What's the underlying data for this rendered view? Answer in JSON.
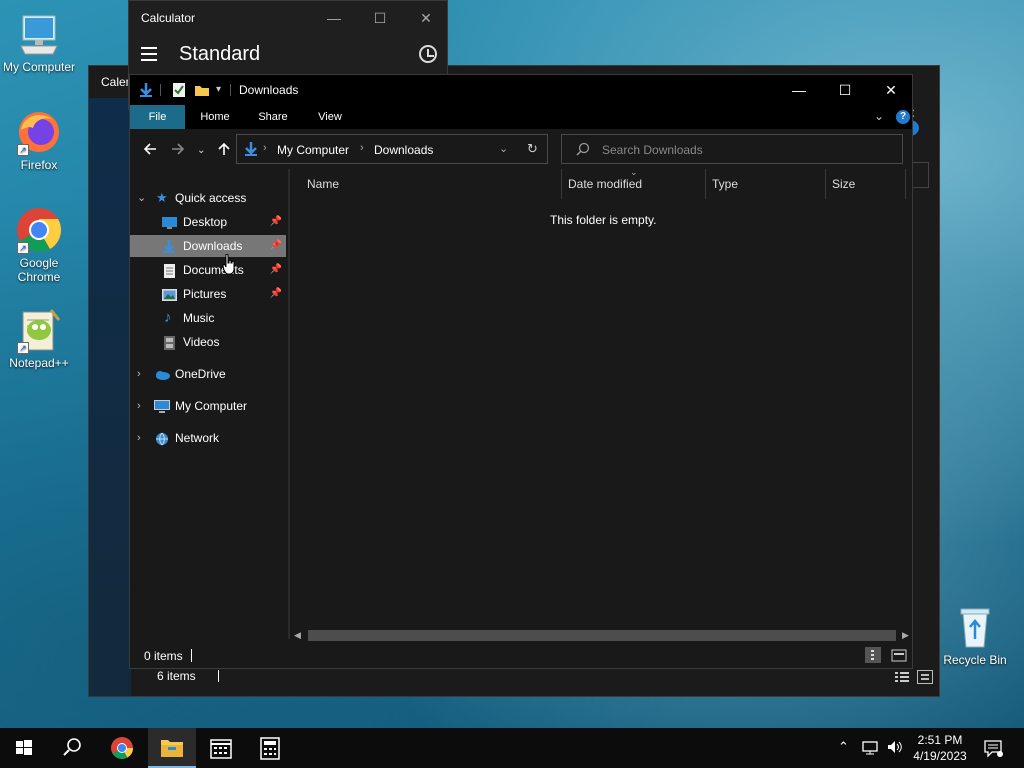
{
  "desktop": {
    "icons": [
      {
        "label": "My Computer"
      },
      {
        "label": "Firefox"
      },
      {
        "label": "Google Chrome"
      },
      {
        "label": "Notepad++"
      },
      {
        "label": "Recycle Bin"
      }
    ]
  },
  "calculator": {
    "title": "Calculator",
    "mode": "Standard",
    "min_glyph": "—",
    "max_glyph": "☐",
    "close_glyph": "✕"
  },
  "calendar": {
    "title": "Calen",
    "status_items": "6 items"
  },
  "explorer": {
    "title": "Downloads",
    "ribbon_tabs": [
      "File",
      "Home",
      "Share",
      "View"
    ],
    "help_glyph": "?",
    "address": {
      "crumbs": [
        "My Computer",
        "Downloads"
      ]
    },
    "search_placeholder": "Search Downloads",
    "nav": {
      "quick_access": "Quick access",
      "pinned": [
        "Desktop",
        "Downloads",
        "Documents",
        "Pictures"
      ],
      "unpinned": [
        "Music",
        "Videos"
      ],
      "roots": [
        "OneDrive",
        "My Computer",
        "Network"
      ]
    },
    "columns": [
      "Name",
      "Date modified",
      "Type",
      "Size"
    ],
    "empty_message": "This folder is empty.",
    "status_items": "0 items"
  },
  "taskbar": {
    "time": "2:51 PM",
    "date": "4/19/2023",
    "apps": [
      "Start",
      "Search",
      "Google Chrome",
      "File Explorer",
      "Calendar",
      "Calculator"
    ]
  },
  "colors": {
    "accent": "#1d6b8a",
    "selection": "#777777",
    "taskbar_active_underline": "#79b8e8"
  }
}
